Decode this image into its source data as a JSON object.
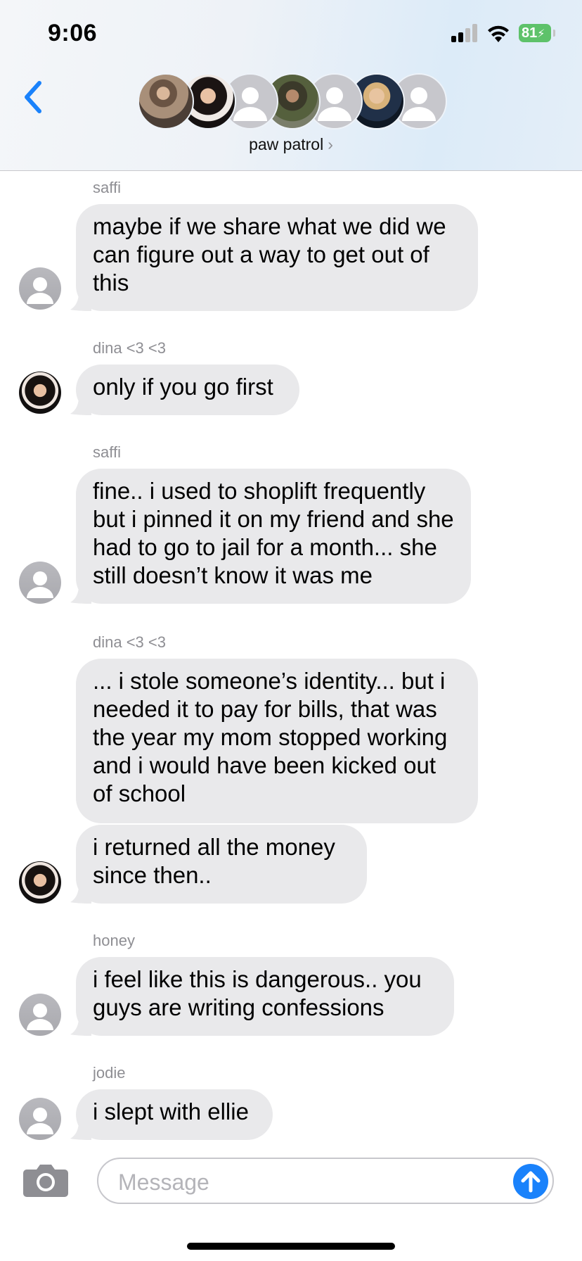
{
  "status_bar": {
    "time": "9:06",
    "battery": "81"
  },
  "header": {
    "group_name": "paw patrol",
    "chevron": "›"
  },
  "messages": [
    {
      "sender": "saffi",
      "text": "maybe if we share what we did we can figure out a way to get out of this"
    },
    {
      "sender": "dina <3 <3",
      "text": "only if you go first"
    },
    {
      "sender": "saffi",
      "text": "fine.. i used to shoplift frequently but i pinned it on my friend and she had to go to jail for a month... she still doesn’t know it was me"
    },
    {
      "sender": "dina <3 <3",
      "text": "... i stole someone’s identity... but i needed it to pay for bills, that was the year my mom stopped working and i would have been kicked out of school"
    },
    {
      "text": "i returned all the money since then.."
    },
    {
      "sender": "honey",
      "text": "i feel like this is dangerous.. you guys are writing confessions"
    },
    {
      "sender": "jodie",
      "text": "i slept with ellie"
    }
  ],
  "composer": {
    "placeholder": "Message"
  },
  "colors": {
    "accent": "#1a82fb",
    "bubble": "#e9e9eb",
    "battery": "#5ec26a"
  },
  "icons": [
    "back-chevron-icon",
    "camera-icon",
    "send-arrow-icon",
    "wifi-icon",
    "signal-icon"
  ]
}
